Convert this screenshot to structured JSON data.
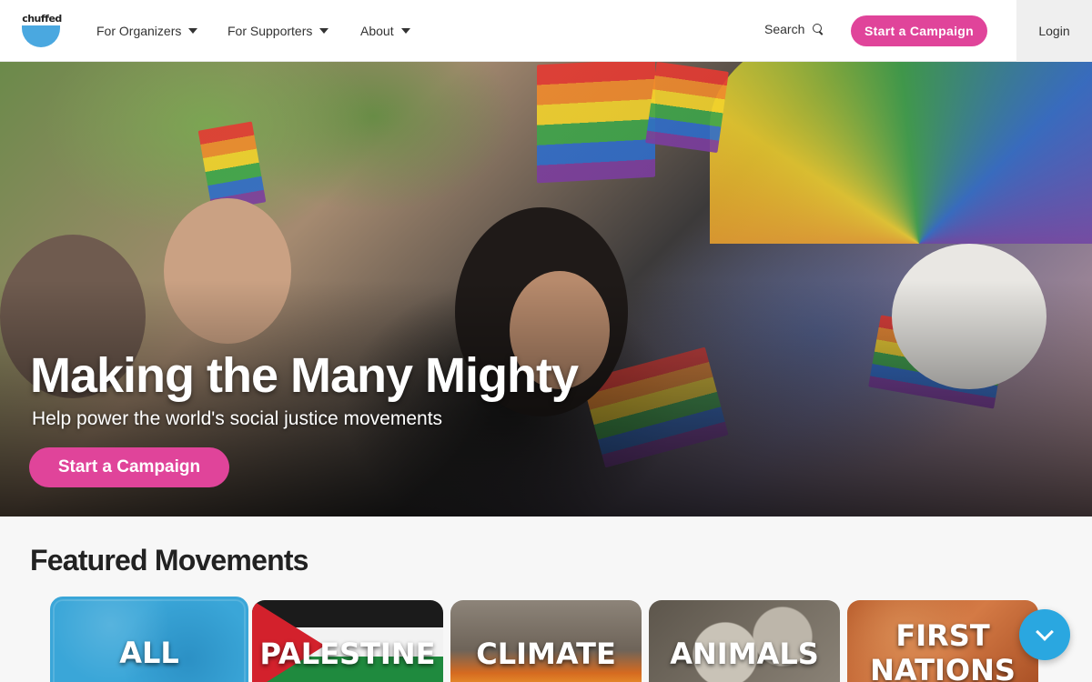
{
  "header": {
    "logo_text": "chuffed",
    "nav": [
      {
        "label": "For Organizers",
        "icon": "caret-down-icon"
      },
      {
        "label": "For Supporters",
        "icon": "caret-down-icon"
      },
      {
        "label": "About",
        "icon": "caret-down-icon"
      }
    ],
    "search_label": "Search",
    "cta_label": "Start a Campaign",
    "login_label": "Login"
  },
  "hero": {
    "title": "Making the Many Mighty",
    "subtitle": "Help power the world's social justice movements",
    "cta_label": "Start a Campaign"
  },
  "featured": {
    "title": "Featured Movements",
    "cards": [
      {
        "label": "ALL",
        "selected": true
      },
      {
        "label": "PALESTINE"
      },
      {
        "label": "CLIMATE"
      },
      {
        "label": "ANIMALS"
      },
      {
        "label": "FIRST NATIONS"
      }
    ]
  },
  "colors": {
    "brand_pink": "#e0449a",
    "brand_blue": "#4aa8e0",
    "chat_blue": "#2aa7e0"
  },
  "chat": {
    "icon": "chevron-down-icon"
  }
}
